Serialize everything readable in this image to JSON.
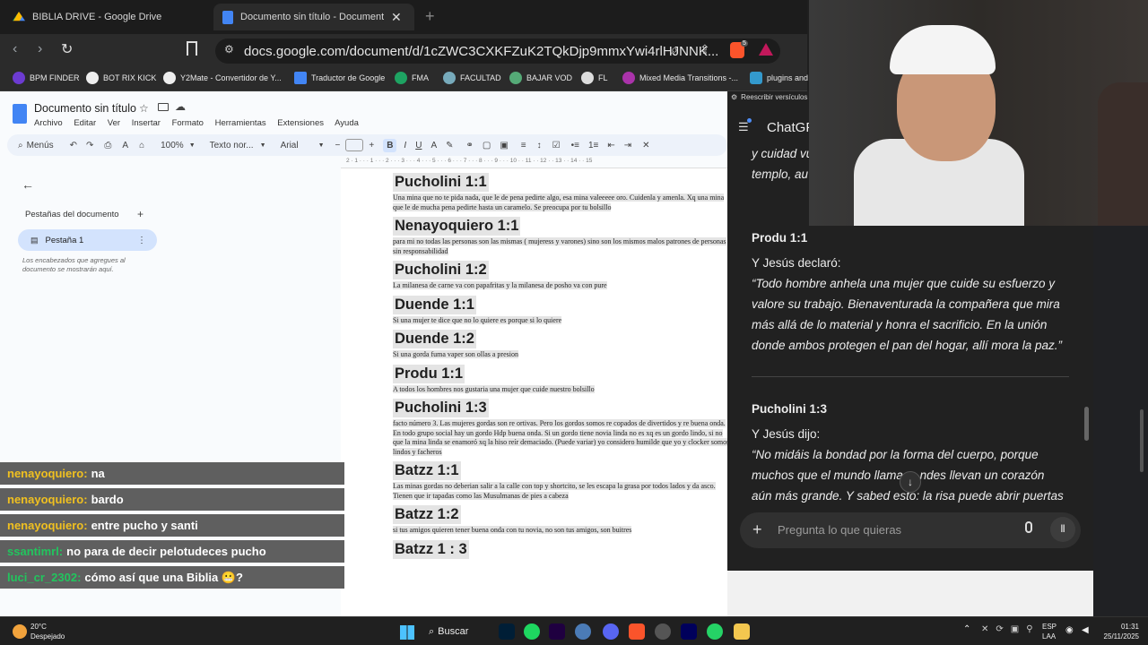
{
  "browser": {
    "tabs": [
      {
        "title": "BIBLIA DRIVE - Google Drive"
      },
      {
        "title": "Documento sin título - Documentos de Goo"
      }
    ],
    "url": "docs.google.com/document/d/1cZWC3CXKFZuK2TQkDjp9mmxYwi4rlHJNNK...",
    "ext_badge": "5",
    "bookmarks": [
      "BPM FINDER",
      "BOT RIX KICK",
      "Y2Mate - Convertidor de Y...",
      "Traductor de Google",
      "FMA",
      "FACULTAD",
      "BAJAR VOD",
      "FL",
      "Mixed Media Transitions -...",
      "plugins and"
    ],
    "accent": "#7cacf8"
  },
  "docs": {
    "title": "Documento sin título",
    "menu": [
      "Archivo",
      "Editar",
      "Ver",
      "Insertar",
      "Formato",
      "Herramientas",
      "Extensiones",
      "Ayuda"
    ],
    "toolbar": {
      "menus": "Menús",
      "zoom": "100%",
      "style": "Texto nor...",
      "font": "Arial"
    },
    "ruler": "2 · 1 · · · 1 · · · 2 · · · 3 · · · 4 · · · 5 · · · 6 · · · 7 · · · 8 · · · 9 · · · 10 · · 11 · · 12 · · 13 · · 14 · · 15",
    "sidebar": {
      "heading": "Pestañas del documento",
      "tab": "Pestaña 1",
      "hint": "Los encabezados que agregues al documento se mostrarán aquí."
    },
    "sections": [
      {
        "h": "Pucholini 1:1",
        "p": "Una mina que no te pida nada, que le de pena pedirte algo, esa mina valeeeee oro. Cuidenla y amenla. Xq una mina que le de mucha pena pedirte hasta un caramelo. Se preocupa por tu bolsillo"
      },
      {
        "h": "Nenayoquiero 1:1",
        "p": " para mi no todas las personas son las mismas ( mujeress y varones) sino son los mismos malos patrones de personas sin responsabilidad"
      },
      {
        "h": "Pucholini 1:2",
        "p": "La milanesa de carne va con papafritas y la milanesa de posho va con pure"
      },
      {
        "h": "Duende 1:1",
        "p": "Si una mujer te dice que no lo quiere es porque si lo quiere"
      },
      {
        "h": "Duende 1:2",
        "p": "Si una gorda fuma vaper son ollas a presion"
      },
      {
        "h": "Produ 1:1",
        "p": "A todos los hombres nos gustaria una mujer que cuide nuestro bolsillo"
      },
      {
        "h": "Pucholini 1:3",
        "p": "facto número 3. Las mujeres gordas son re ortivas. Pero los gordos somos re copados de divertidos y re buena onda. En todo grupo social hay un gordo Hdp buena onda. Si un gordo tiene novia linda no es xq es un gordo lindo, si no que la mina linda se enamoró xq la hiso reír demaciado. (Puede variar) yo considero humilde que yo y clocker somos lindos y facheros"
      },
      {
        "h": "Batzz 1:1",
        "p": "Las minas gordas no deberian salir a la calle con top y shortcito, se les escapa la grasa por todos lados y da asco. Tienen que ir tapadas como las Musulmanas de pies a cabeza"
      },
      {
        "h": "Batzz 1:2",
        "p": "si tus amigos quieren tener buena onda con tu novia, no son tus amigos, son buitres"
      },
      {
        "h": "Batzz 1 : 3",
        "p": ""
      }
    ]
  },
  "stream_chat": [
    {
      "user": "nenayoquiero:",
      "msg": "na",
      "color": "#f0c020"
    },
    {
      "user": "nenayoquiero:",
      "msg": "bardo",
      "color": "#f0c020"
    },
    {
      "user": "nenayoquiero:",
      "msg": "entre pucho y santi",
      "color": "#f0c020"
    },
    {
      "user": "ssantimrl:",
      "msg": "no para de decir pelotudeces pucho",
      "color": "#22c55e"
    },
    {
      "user": "luci_cr_2302:",
      "msg": "cómo así que una Biblia 😬?",
      "color": "#22c55e"
    }
  ],
  "chatgpt": {
    "popup": "Reescribir versículos",
    "brand": "ChatGP",
    "top_text": [
      "y cuidad vu",
      "templo, au"
    ],
    "block1": {
      "title": "Produ 1:1",
      "intro": "Y Jesús declaró:",
      "quote": "“Todo hombre anhela una mujer que cuide su esfuerzo y valore su trabajo. Bienaventurada la compañera que mira más allá de lo material y honra el sacrificio. En la unión donde ambos protegen el pan del hogar, allí mora la paz.”"
    },
    "block2": {
      "title": "Pucholini 1:3",
      "intro": "Y Jesús dijo:",
      "quote": "“No midáis la bondad por la forma del cuerpo, porque muchos que el mundo llama ... ndes llevan un corazón aún más grande. Y sabed esto: la risa puede abrir puertas que el"
    },
    "input_placeholder": "Pregunta lo que quieras"
  },
  "taskbar": {
    "weather_temp": "20°C",
    "weather_desc": "Despejado",
    "search": "Buscar",
    "lang1": "ESP",
    "lang2": "LAA",
    "time": "01:31",
    "date": "25/11/2025"
  }
}
